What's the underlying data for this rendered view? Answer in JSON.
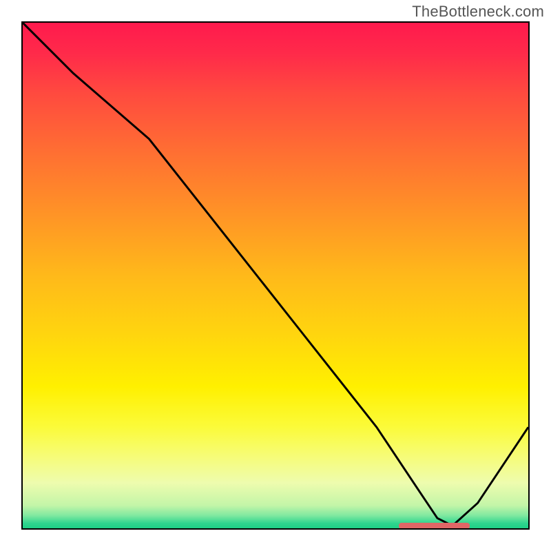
{
  "watermark": "TheBottleneck.com",
  "colors": {
    "gradient_stops": [
      {
        "offset": 0.0,
        "color": "#ff1a4d"
      },
      {
        "offset": 0.06,
        "color": "#ff2a4a"
      },
      {
        "offset": 0.14,
        "color": "#ff4a3f"
      },
      {
        "offset": 0.25,
        "color": "#ff6d33"
      },
      {
        "offset": 0.38,
        "color": "#ff9426"
      },
      {
        "offset": 0.5,
        "color": "#ffb91a"
      },
      {
        "offset": 0.62,
        "color": "#ffd60e"
      },
      {
        "offset": 0.72,
        "color": "#fff000"
      },
      {
        "offset": 0.8,
        "color": "#fbfb3a"
      },
      {
        "offset": 0.86,
        "color": "#f6fc7a"
      },
      {
        "offset": 0.91,
        "color": "#eefcae"
      },
      {
        "offset": 0.955,
        "color": "#c3f5a8"
      },
      {
        "offset": 0.975,
        "color": "#7fe8a0"
      },
      {
        "offset": 0.99,
        "color": "#2fd58f"
      },
      {
        "offset": 1.0,
        "color": "#1ecf86"
      }
    ],
    "axis": "#000000",
    "curve": "#000000",
    "dash": "#e06666"
  },
  "chart_data": {
    "type": "line",
    "title": "",
    "xlabel": "",
    "ylabel": "",
    "xlim": [
      0,
      100
    ],
    "ylim": [
      0,
      100
    ],
    "series": [
      {
        "name": "curve",
        "x": [
          0,
          10,
          25,
          40,
          55,
          70,
          78,
          82,
          85,
          90,
          100
        ],
        "y": [
          100,
          90,
          77,
          58,
          39,
          20,
          8,
          2,
          0.5,
          5,
          20
        ]
      }
    ],
    "annotations": {
      "dash_band": {
        "x_start": 74,
        "x_end": 88,
        "y": 1,
        "note": "flat-minimum marker"
      }
    }
  }
}
